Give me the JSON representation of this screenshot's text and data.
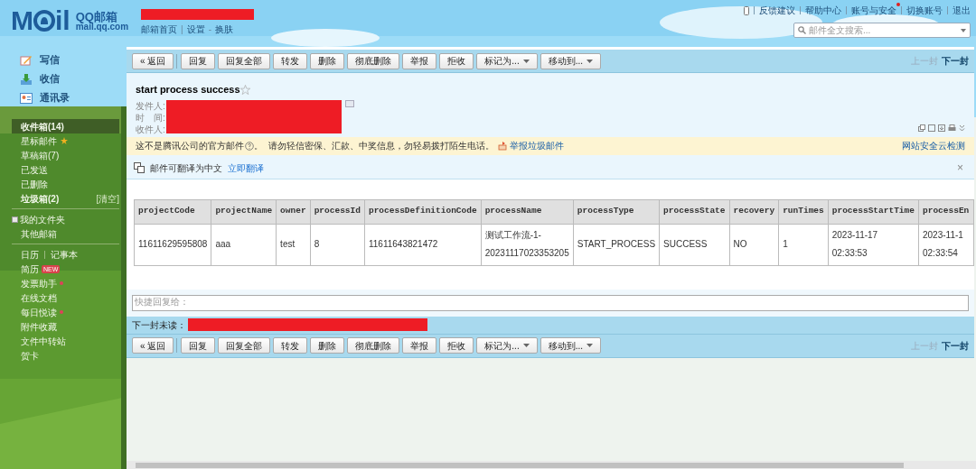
{
  "header": {
    "logo_parts": [
      "M",
      "il"
    ],
    "brand": "QQ邮箱",
    "domain": "mail.qq.com",
    "links": [
      {
        "label": "邮箱首页",
        "sep": "|"
      },
      {
        "label": "设置",
        "sep": "-"
      },
      {
        "label": "换肤"
      }
    ],
    "top_links": [
      {
        "label": "反馈建议",
        "dot": false
      },
      {
        "label": "帮助中心",
        "dot": false
      },
      {
        "label": "账号与安全",
        "dot": true
      },
      {
        "label": "切换账号",
        "dot": false
      },
      {
        "label": "退出",
        "dot": false
      }
    ],
    "search": {
      "placeholder": "邮件全文搜索..."
    }
  },
  "sidebar": {
    "actions": [
      {
        "kind": "compose",
        "label": "写信"
      },
      {
        "kind": "inbox",
        "label": "收信"
      },
      {
        "kind": "contacts",
        "label": "通讯录"
      }
    ],
    "folders": [
      {
        "label": "收件箱(14)",
        "selected": true,
        "bold": true
      },
      {
        "label": "星标邮件",
        "selected": false,
        "bold": false,
        "kind": "star"
      },
      {
        "label": "草稿箱(7)",
        "selected": false,
        "bold": false
      },
      {
        "label": "已发送",
        "selected": false,
        "bold": false
      },
      {
        "label": "已删除",
        "selected": false,
        "bold": false
      },
      {
        "label": "垃圾箱(2)",
        "selected": false,
        "bold": true,
        "action": "[清空]"
      }
    ],
    "my_folders": {
      "label": "我的文件夹",
      "expanded": false
    },
    "other": "其他邮箱",
    "calendar": [
      "日历",
      "记事本"
    ],
    "tools": [
      {
        "label": "简历",
        "badge": "NEW"
      },
      {
        "label": "发票助手",
        "kind": "dot"
      },
      {
        "label": "在线文档"
      },
      {
        "label": "每日悦读",
        "kind": "dot"
      },
      {
        "label": "附件收藏"
      },
      {
        "label": "文件中转站"
      },
      {
        "label": "贺卡"
      }
    ]
  },
  "toolbars": [
    {
      "buttons": [
        {
          "label": "« 返回",
          "kind": "button"
        },
        {
          "label": "回复",
          "kind": "button"
        },
        {
          "label": "回复全部",
          "kind": "button"
        },
        {
          "label": "转发",
          "kind": "button"
        },
        {
          "label": "删除",
          "kind": "button"
        },
        {
          "label": "彻底删除",
          "kind": "button"
        },
        {
          "label": "举报",
          "kind": "button"
        },
        {
          "label": "拒收",
          "kind": "button"
        },
        {
          "label": "标记为...",
          "kind": "dropdown"
        },
        {
          "label": "移动到...",
          "kind": "dropdown"
        }
      ],
      "prev": {
        "label": "上一封",
        "disabled": true
      },
      "next": {
        "label": "下一封",
        "disabled": false
      }
    },
    {
      "buttons": [
        {
          "label": "« 返回",
          "kind": "button"
        },
        {
          "label": "回复",
          "kind": "button"
        },
        {
          "label": "回复全部",
          "kind": "button"
        },
        {
          "label": "转发",
          "kind": "button"
        },
        {
          "label": "删除",
          "kind": "button"
        },
        {
          "label": "彻底删除",
          "kind": "button"
        },
        {
          "label": "举报",
          "kind": "button"
        },
        {
          "label": "拒收",
          "kind": "button"
        },
        {
          "label": "标记为...",
          "kind": "dropdown"
        },
        {
          "label": "移动到...",
          "kind": "dropdown"
        }
      ],
      "prev": {
        "label": "上一封",
        "disabled": true
      },
      "next": {
        "label": "下一封",
        "disabled": false
      }
    }
  ],
  "mail": {
    "subject": "start process success",
    "starred": false,
    "fields": [
      "发件人:",
      "时　间:",
      "收件人:"
    ],
    "warning": {
      "lead": "这不是腾讯公司的官方邮件",
      "text": "。  请勿轻信密保、汇款、中奖信息，勿轻易拨打陌生电话。",
      "report": "举报垃圾邮件",
      "check": "网站安全云检测"
    },
    "translate": {
      "text": "邮件可翻译为中文",
      "link": "立即翻译",
      "close": "×"
    }
  },
  "table": {
    "columns": [
      "projectCode",
      "projectName",
      "owner",
      "processId",
      "processDefinitionCode",
      "processName",
      "processType",
      "processState",
      "recovery",
      "runTimes",
      "processStartTime",
      "processEn"
    ],
    "rows": [
      [
        "11611629595808",
        "aaa",
        "test",
        "8",
        "11611643821472",
        "测试工作流-1-20231117023353205",
        "START_PROCESS",
        "SUCCESS",
        "NO",
        "1",
        "2023-11-17 02:33:53",
        "2023-11-1 02:33:54"
      ]
    ]
  },
  "quick_reply": {
    "placeholder": "快捷回复给："
  },
  "next_unread": {
    "label": "下一封未读："
  }
}
